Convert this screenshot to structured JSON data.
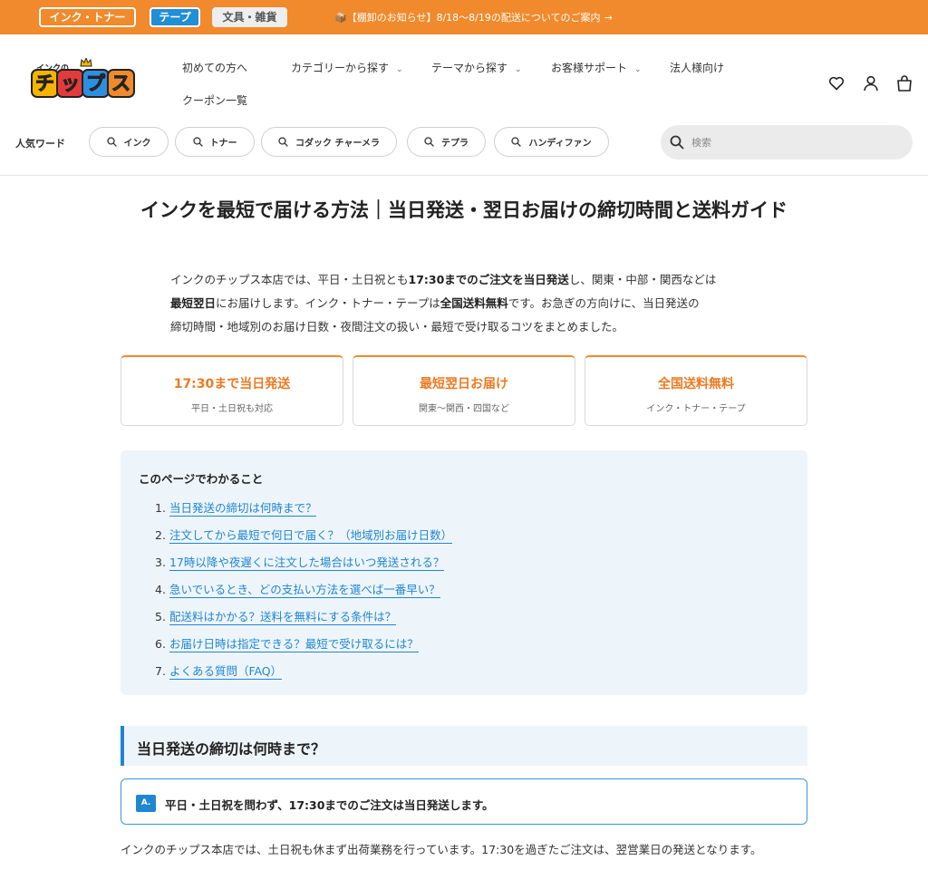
{
  "topbar": {
    "ink_toner": "インク・トナー",
    "tape": "テープ",
    "stationery": "文具・雑貨",
    "notice": "📦【棚卸のお知らせ】8/18〜8/19の配送についてのご案内",
    "notice_arrow": "→"
  },
  "logo": {
    "small_text": "インクの",
    "chars": [
      "チ",
      "ッ",
      "プ",
      "ス"
    ],
    "colors": [
      "#f5b400",
      "#e33b3b",
      "#2e8fe0",
      "#f08a2c"
    ]
  },
  "nav": {
    "beginners": "初めての方へ",
    "categories": "カテゴリーから探す",
    "themes": "テーマから探す",
    "support": "お客様サポート",
    "corporate": "法人様向け",
    "coupons": "クーポン一覧",
    "chevron": "⌄"
  },
  "popular": {
    "label": "人気ワード",
    "chips": [
      "インク",
      "トナー",
      "コダック チャーメラ",
      "テプラ",
      "ハンディファン"
    ]
  },
  "search": {
    "placeholder": "検索"
  },
  "main": {
    "title": "インクを最短で届ける方法｜当日発送・翌日お届けの締切時間と送料ガイド",
    "intro": {
      "l1_a": "インクのチップス本店では、平日・土日祝とも",
      "l1_b": "17:30までのご注文を当日発送",
      "l1_c": "し、関東・中部・関西などは",
      "l2_a": "最短翌日",
      "l2_b": "にお届けします。インク・トナー・テープは",
      "l2_c": "全国送料無料",
      "l2_d": "です。お急ぎの方向けに、当日発送の",
      "l3": "締切時間・地域別のお届け日数・夜間注文の扱い・最短で受け取るコツをまとめました。"
    },
    "features": [
      {
        "title": "17:30まで当日発送",
        "sub": "平日・土日祝も対応"
      },
      {
        "title": "最短翌日お届け",
        "sub": "関東〜関西・四国など"
      },
      {
        "title": "全国送料無料",
        "sub": "インク・トナー・テープ"
      }
    ],
    "toc": {
      "title": "このページでわかること",
      "items": [
        {
          "num": "1.",
          "text": "当日発送の締切は何時まで？"
        },
        {
          "num": "2.",
          "text": "注文してから最短で何日で届く？（地域別お届け日数）"
        },
        {
          "num": "3.",
          "text": "17時以降や夜遅くに注文した場合はいつ発送される？"
        },
        {
          "num": "4.",
          "text": "急いでいるとき、どの支払い方法を選べば一番早い？"
        },
        {
          "num": "5.",
          "text": "配送料はかかる？送料を無料にする条件は？"
        },
        {
          "num": "6.",
          "text": "お届け日時は指定できる？最短で受け取るには？"
        },
        {
          "num": "7.",
          "text": "よくある質問（FAQ）"
        }
      ]
    },
    "section1": {
      "heading": "当日発送の締切は何時まで？",
      "badge": "A.",
      "answer": "平日・土日祝を問わず、17:30までのご注文は当日発送します。",
      "body": "インクのチップス本店では、土日祝も休まず出荷業務を行っています。17:30を過ぎたご注文は、翌営業日の発送となります。"
    }
  },
  "colors": {
    "accent_orange": "#f08a2c",
    "link_blue": "#1f86d2",
    "tape_blue": "#1f8fd6",
    "toc_bg": "#eef5fa"
  }
}
